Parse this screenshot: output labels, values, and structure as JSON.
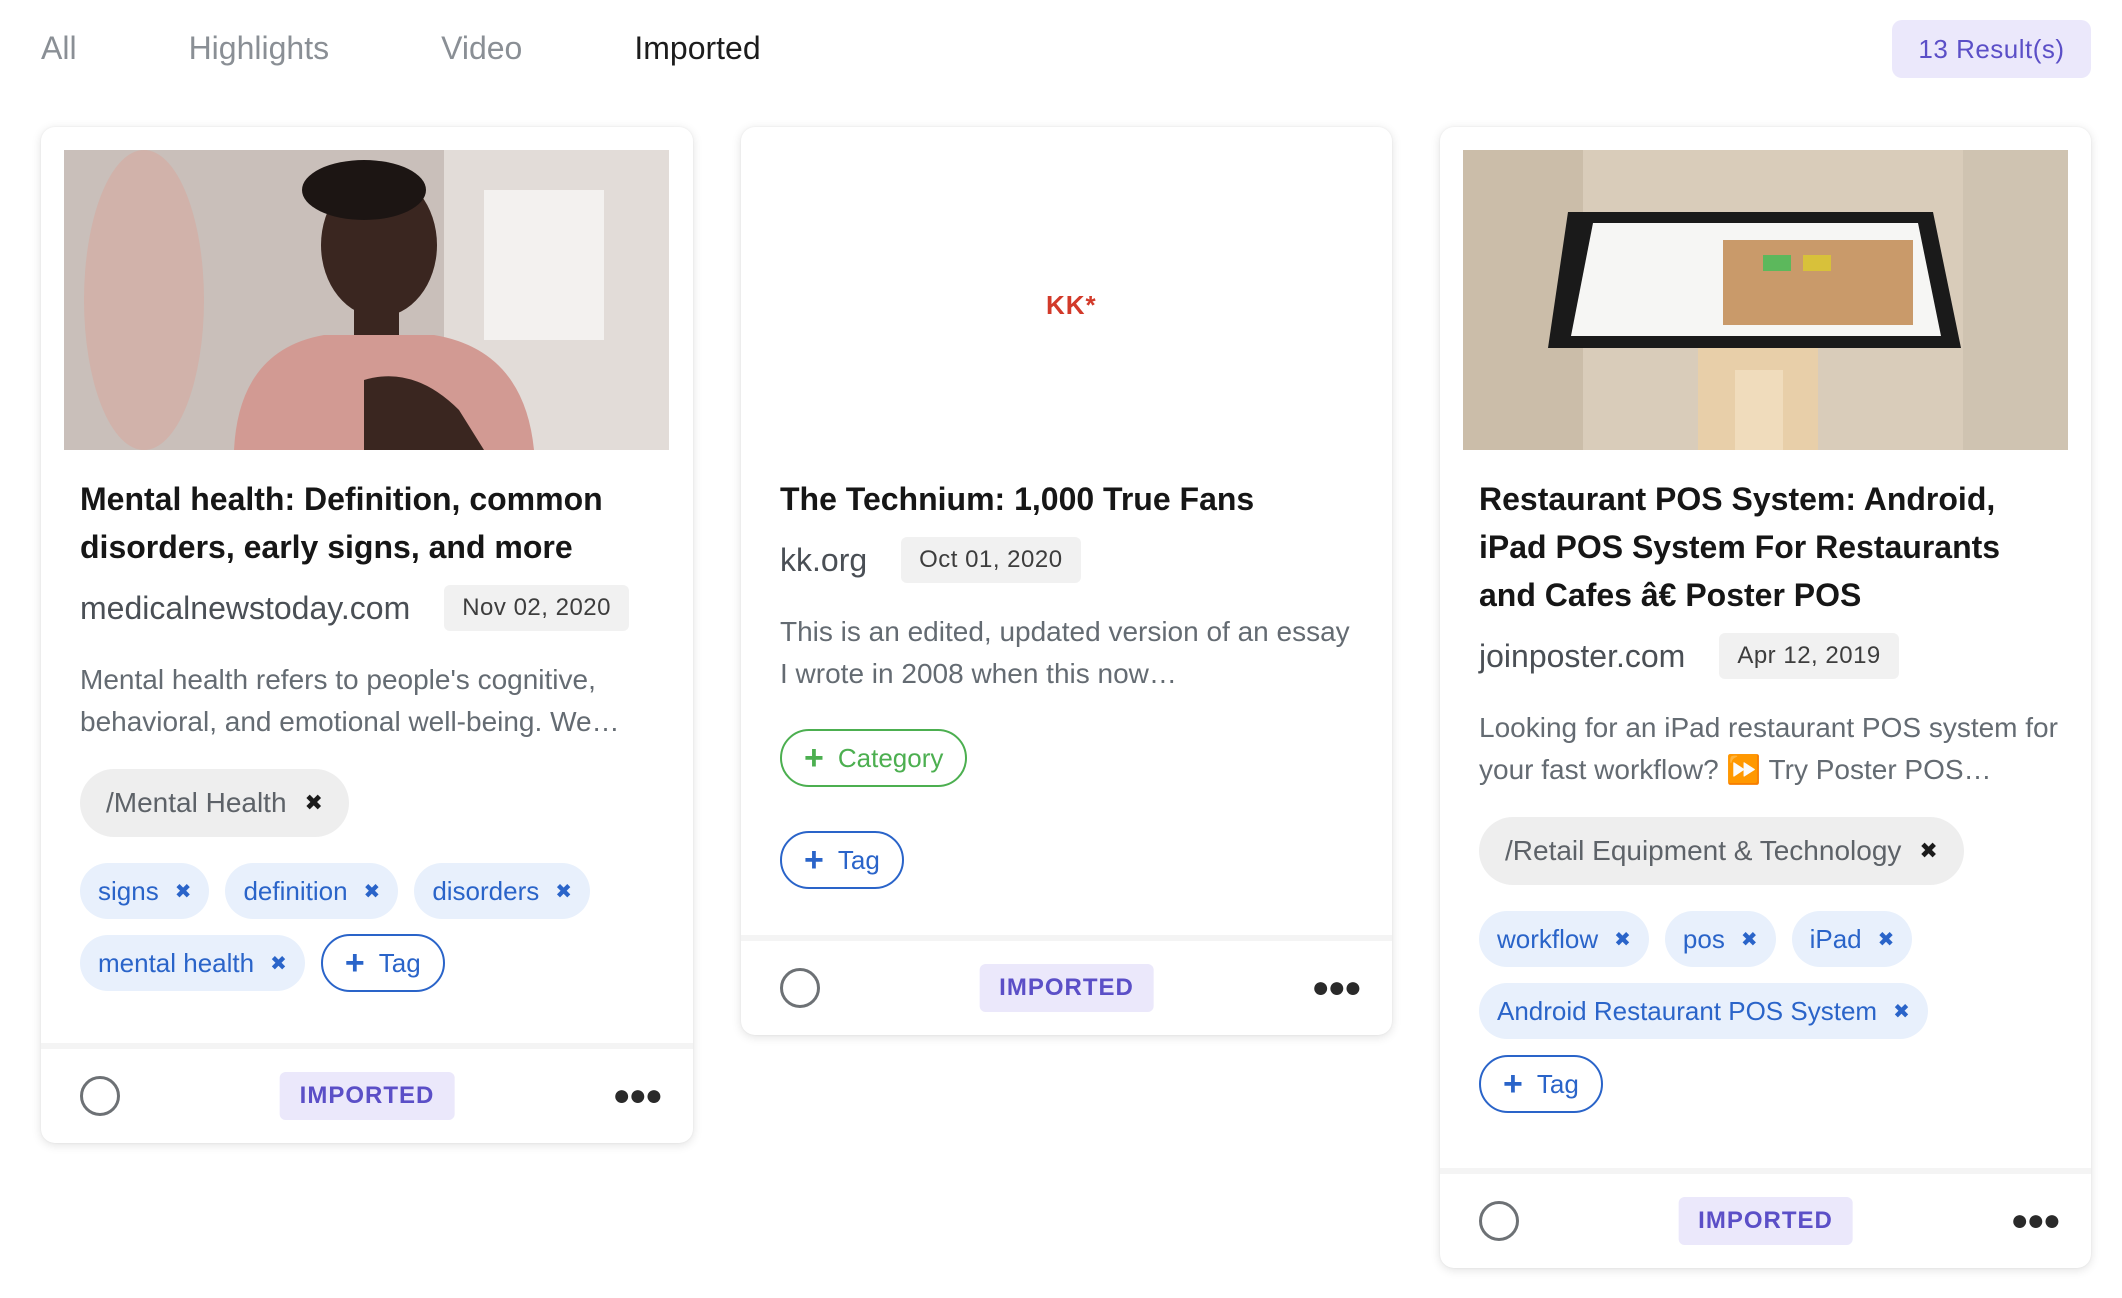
{
  "tabs": [
    "All",
    "Highlights",
    "Video",
    "Imported"
  ],
  "active_tab": "Imported",
  "results_label": "13 Result(s)",
  "cards": [
    {
      "title": "Mental health: Definition, common disorders, early signs, and more",
      "domain": "medicalnewstoday.com",
      "date": "Nov 02, 2020",
      "description": "Mental health refers to people's cognitive, behavioral, and emotional well-being. We…",
      "category": "/Mental Health",
      "tags": [
        "signs",
        "definition",
        "disorders",
        "mental health"
      ],
      "add_tag_label": "Tag",
      "status": "IMPORTED"
    },
    {
      "thumbnail_text": "KK*",
      "title": "The Technium: 1,000 True Fans",
      "domain": "kk.org",
      "date": "Oct 01, 2020",
      "description": "This is an edited, updated version of an essay I wrote in 2008 when this now…",
      "add_category_label": "Category",
      "add_tag_label": "Tag",
      "status": "IMPORTED"
    },
    {
      "title": "Restaurant POS System: Android, iPad POS System For Restaurants and Cafes â€  Poster POS",
      "domain": "joinposter.com",
      "date": "Apr 12, 2019",
      "description": "Looking for an iPad restaurant POS system for your fast workflow? ⏩ Try Poster POS…",
      "category": "/Retail Equipment & Technology",
      "tags": [
        "workflow",
        "pos",
        "iPad",
        "Android Restaurant POS System"
      ],
      "add_tag_label": "Tag",
      "status": "IMPORTED"
    }
  ],
  "icons": {
    "remove": "close-icon",
    "add": "plus-icon",
    "more": "more-horizontal-icon",
    "select": "radio-icon"
  },
  "colors": {
    "accent_purple": "#5b4fc7",
    "badge_bg": "#ebe8fb",
    "tag_blue": "#2a64c9",
    "tag_bg": "#e8f0fc",
    "category_green": "#4caf50",
    "kk_red": "#d23a2a"
  }
}
